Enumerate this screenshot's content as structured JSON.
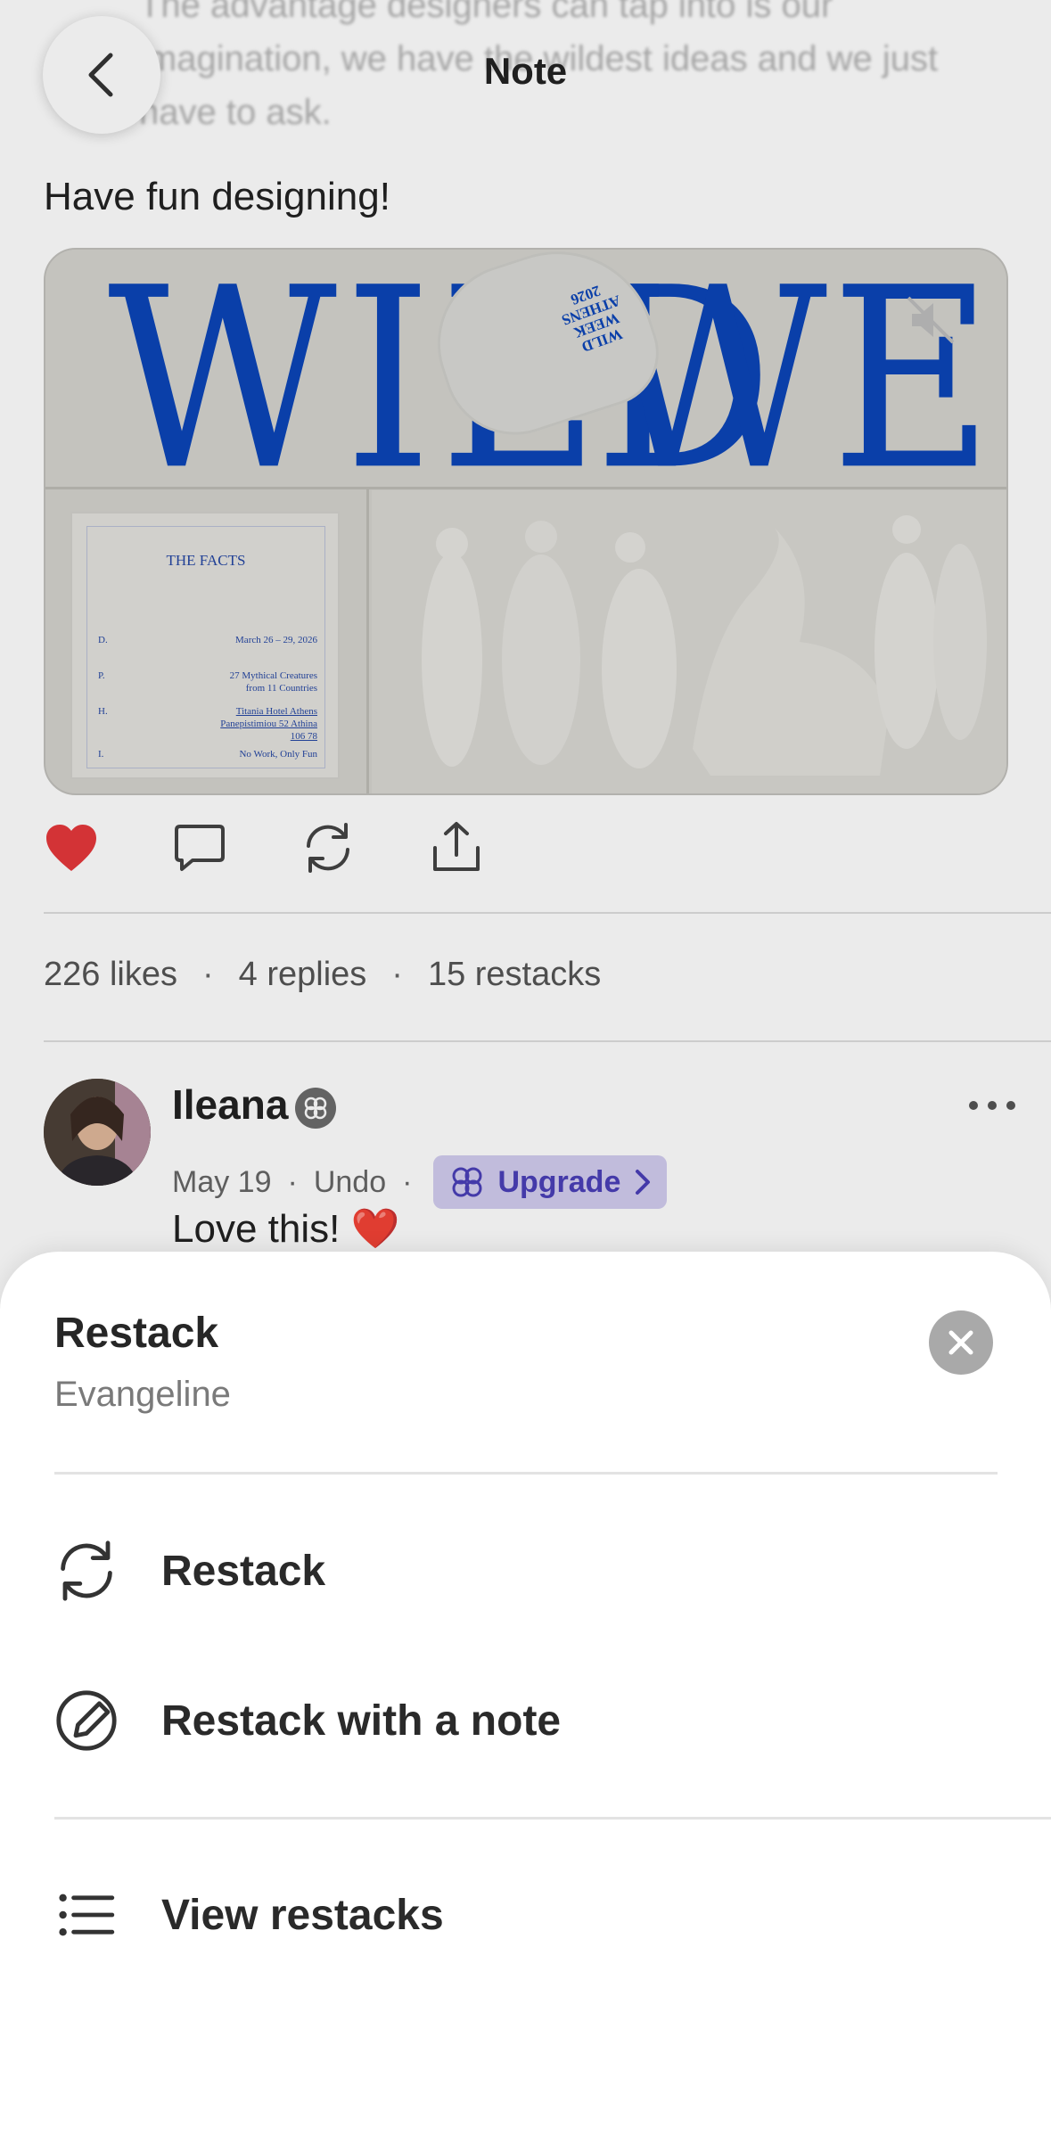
{
  "header": {
    "title": "Note",
    "faded_text": "The advantage designers can tap into is our imagination, we have the wildest ideas and we just have to ask."
  },
  "note": {
    "body": "Have fun designing!",
    "media": {
      "headline_left": "WILD",
      "headline_right": "WEEK",
      "vase_label": "WILD WEEK ATHENS 2026",
      "facts": {
        "title": "THE FACTS",
        "rows": [
          {
            "key": "D.",
            "value": "March 26 – 29, 2026"
          },
          {
            "key": "P.",
            "value": "27 Mythical Creatures from 11 Countries"
          },
          {
            "key": "H.",
            "value": "Titania Hotel Athens Panepistimiou 52 Athina 106 78"
          },
          {
            "key": "I.",
            "value": "No Work, Only Fun"
          }
        ]
      }
    }
  },
  "stats": {
    "likes": "226 likes",
    "replies": "4 replies",
    "restacks": "15 restacks"
  },
  "reply": {
    "name": "Ileana",
    "date": "May 19",
    "undo": "Undo",
    "upgrade": "Upgrade",
    "text": "Love this! ❤️"
  },
  "sheet": {
    "title": "Restack",
    "subtitle": "Evangeline",
    "options": [
      {
        "label": "Restack",
        "icon": "restack-icon"
      },
      {
        "label": "Restack with a note",
        "icon": "pencil-icon"
      },
      {
        "label": "View restacks",
        "icon": "list-icon"
      }
    ]
  },
  "colors": {
    "accent_blue": "#0b45b8",
    "heart_red": "#e5383b",
    "upgrade_bg": "#d2cdef",
    "upgrade_text": "#4a3fb8"
  }
}
